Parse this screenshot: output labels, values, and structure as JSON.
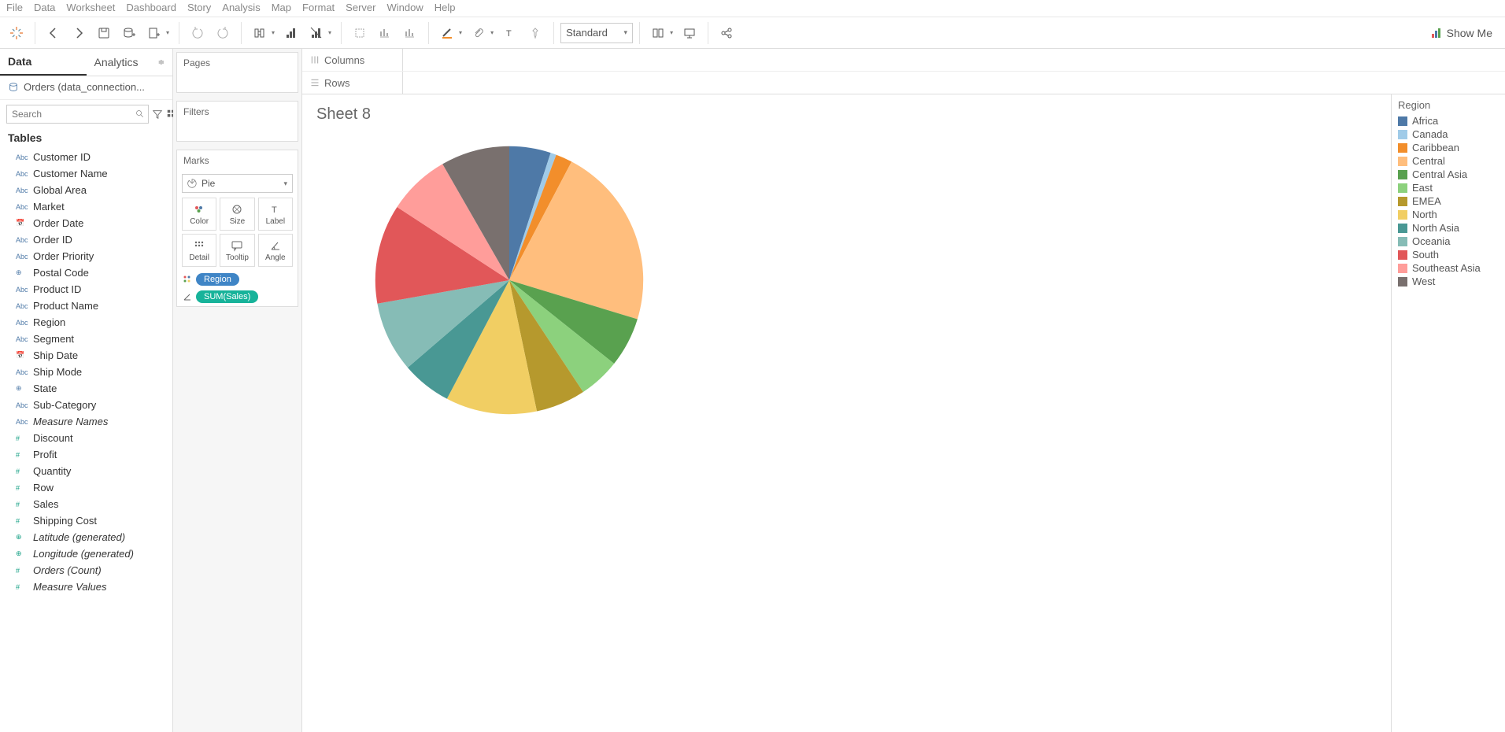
{
  "menu": [
    "File",
    "Data",
    "Worksheet",
    "Dashboard",
    "Story",
    "Analysis",
    "Map",
    "Format",
    "Server",
    "Window",
    "Help"
  ],
  "toolbar": {
    "fit": "Standard",
    "showme": "Show Me"
  },
  "side": {
    "tabs": {
      "data": "Data",
      "analytics": "Analytics"
    },
    "datasource": "Orders (data_connection...",
    "search_placeholder": "Search",
    "tables_label": "Tables",
    "fields": [
      {
        "type": "Abc",
        "name": "Customer ID"
      },
      {
        "type": "Abc",
        "name": "Customer Name"
      },
      {
        "type": "Abc",
        "name": "Global Area"
      },
      {
        "type": "Abc",
        "name": "Market"
      },
      {
        "type": "date",
        "name": "Order Date"
      },
      {
        "type": "Abc",
        "name": "Order ID"
      },
      {
        "type": "Abc",
        "name": "Order Priority"
      },
      {
        "type": "geo",
        "name": "Postal Code"
      },
      {
        "type": "Abc",
        "name": "Product ID"
      },
      {
        "type": "Abc",
        "name": "Product Name"
      },
      {
        "type": "Abc",
        "name": "Region"
      },
      {
        "type": "Abc",
        "name": "Segment"
      },
      {
        "type": "date",
        "name": "Ship Date"
      },
      {
        "type": "Abc",
        "name": "Ship Mode"
      },
      {
        "type": "geo",
        "name": "State"
      },
      {
        "type": "Abc",
        "name": "Sub-Category"
      },
      {
        "type": "Abc",
        "name": "Measure Names",
        "italic": true
      },
      {
        "type": "num",
        "name": "Discount",
        "green": true
      },
      {
        "type": "num",
        "name": "Profit",
        "green": true
      },
      {
        "type": "num",
        "name": "Quantity",
        "green": true
      },
      {
        "type": "num",
        "name": "Row",
        "green": true
      },
      {
        "type": "num",
        "name": "Sales",
        "green": true
      },
      {
        "type": "num",
        "name": "Shipping Cost",
        "green": true
      },
      {
        "type": "geo",
        "name": "Latitude (generated)",
        "italic": true,
        "green": true
      },
      {
        "type": "geo",
        "name": "Longitude (generated)",
        "italic": true,
        "green": true
      },
      {
        "type": "num",
        "name": "Orders (Count)",
        "italic": true,
        "green": true
      },
      {
        "type": "num",
        "name": "Measure Values",
        "italic": true,
        "green": true
      }
    ]
  },
  "cards": {
    "pages": "Pages",
    "filters": "Filters",
    "marks": "Marks",
    "mark_type": "Pie",
    "shelf_cells": [
      "Color",
      "Size",
      "Label",
      "Detail",
      "Tooltip",
      "Angle"
    ],
    "pills": [
      {
        "color": "blue",
        "label": "Region",
        "icon": "dots"
      },
      {
        "color": "green",
        "label": "SUM(Sales)",
        "icon": "angle"
      }
    ]
  },
  "shelves": {
    "columns": "Columns",
    "rows": "Rows"
  },
  "sheet_title": "Sheet 8",
  "chart_data": {
    "type": "pie",
    "title": "Region",
    "series": [
      {
        "name": "Africa",
        "value": 5.0,
        "color": "#4e79a7"
      },
      {
        "name": "Canada",
        "value": 0.7,
        "color": "#a0cbe8"
      },
      {
        "name": "Caribbean",
        "value": 2.0,
        "color": "#f28e2b"
      },
      {
        "name": "Central",
        "value": 22.0,
        "color": "#ffbe7d"
      },
      {
        "name": "Central Asia",
        "value": 6.0,
        "color": "#59a14f"
      },
      {
        "name": "East",
        "value": 5.0,
        "color": "#8cd17d"
      },
      {
        "name": "EMEA",
        "value": 6.0,
        "color": "#b6992d"
      },
      {
        "name": "North",
        "value": 11.0,
        "color": "#f1ce63"
      },
      {
        "name": "North Asia",
        "value": 6.0,
        "color": "#499894"
      },
      {
        "name": "Oceania",
        "value": 8.5,
        "color": "#86bcb6"
      },
      {
        "name": "South",
        "value": 12.0,
        "color": "#e15759"
      },
      {
        "name": "Southeast Asia",
        "value": 7.5,
        "color": "#ff9d9a"
      },
      {
        "name": "West",
        "value": 8.3,
        "color": "#79706e"
      }
    ]
  }
}
